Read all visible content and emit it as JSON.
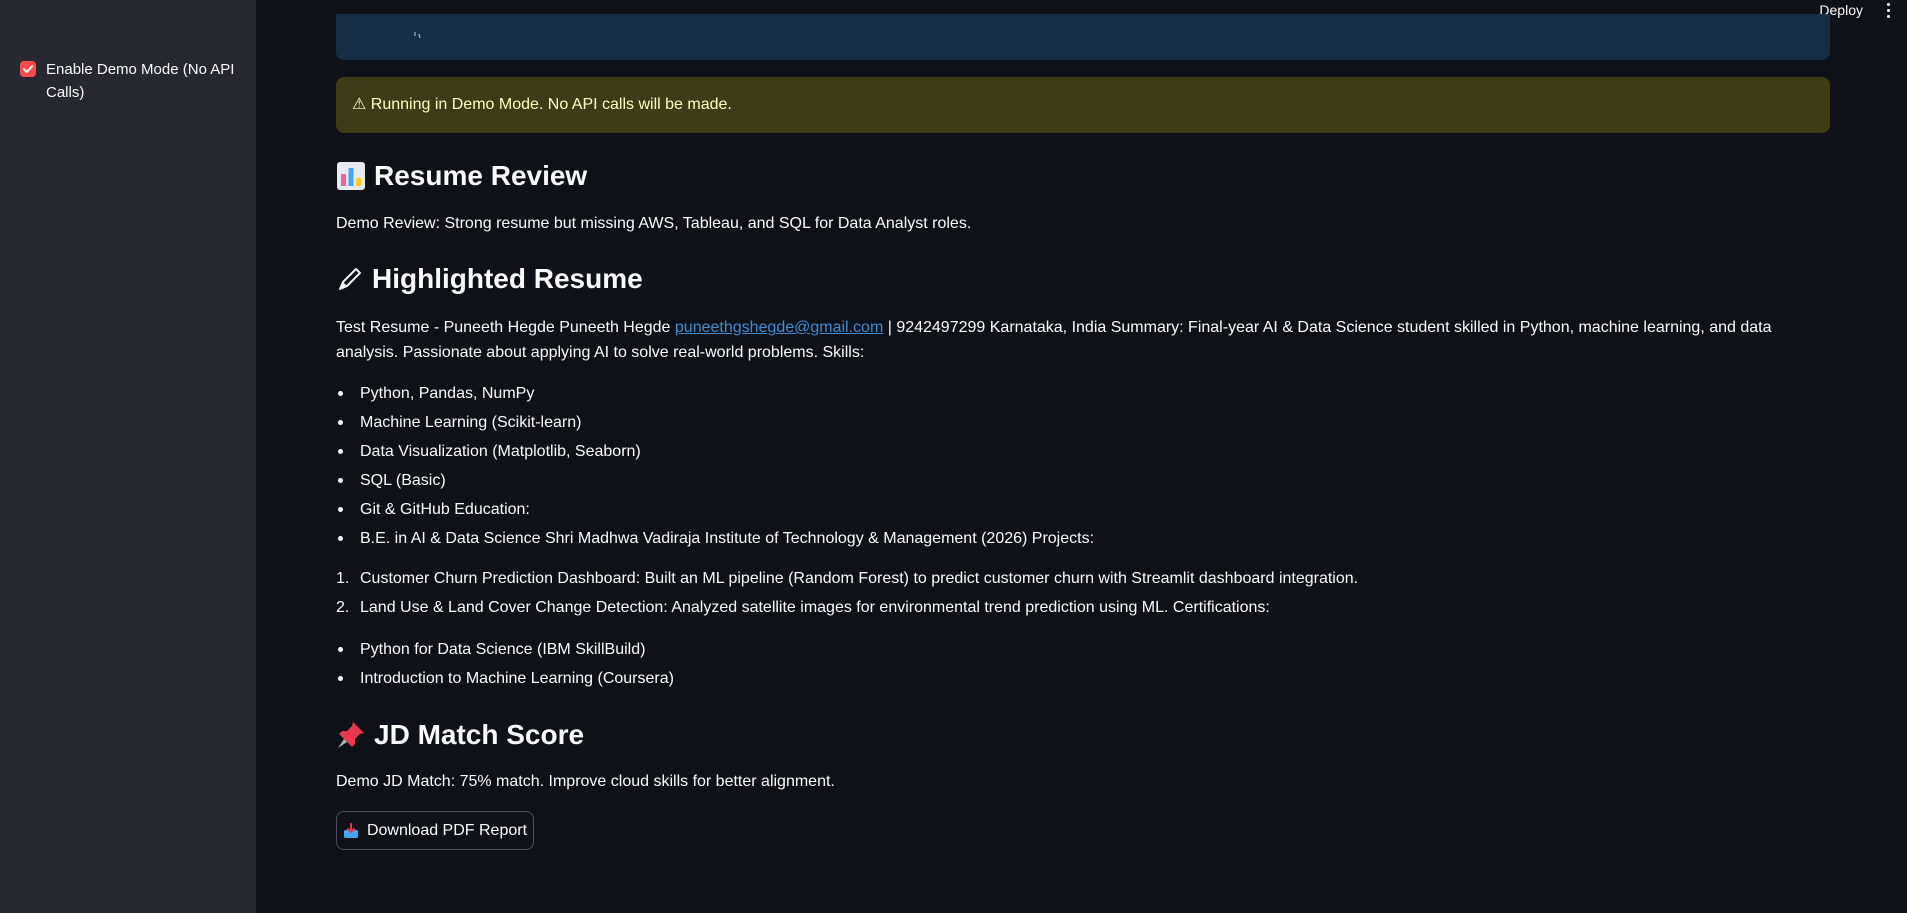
{
  "sidebar": {
    "demo_checkbox": {
      "label": "Enable Demo Mode (No API Calls)",
      "checked": true
    }
  },
  "header": {
    "deploy_label": "Deploy"
  },
  "main": {
    "warning": "⚠ Running in Demo Mode. No API calls will be made.",
    "resume_review": {
      "title": "Resume Review",
      "text": "Demo Review: Strong resume but missing AWS, Tableau, and SQL for Data Analyst roles."
    },
    "highlighted_resume": {
      "title": "Highlighted Resume",
      "intro_before_email": "Test Resume - Puneeth Hegde Puneeth Hegde ",
      "email": "puneethgshegde@gmail.com",
      "intro_after_email": " | 9242497299 Karnataka, India Summary: Final-year AI & Data Science student skilled in Python, machine learning, and data analysis. Passionate about applying AI to solve real-world problems. Skills:",
      "skills": [
        "Python, Pandas, NumPy",
        "Machine Learning (Scikit-learn)",
        "Data Visualization (Matplotlib, Seaborn)",
        "SQL (Basic)",
        "Git & GitHub Education:",
        "B.E. in AI & Data Science Shri Madhwa Vadiraja Institute of Technology & Management (2026) Projects:"
      ],
      "projects": [
        "Customer Churn Prediction Dashboard: Built an ML pipeline (Random Forest) to predict customer churn with Streamlit dashboard integration.",
        "Land Use & Land Cover Change Detection: Analyzed satellite images for environmental trend prediction using ML. Certifications:"
      ],
      "certifications": [
        "Python for Data Science (IBM SkillBuild)",
        "Introduction to Machine Learning (Coursera)"
      ]
    },
    "jd_match": {
      "title": "JD Match Score",
      "text": "Demo JD Match: 75% match. Improve cloud skills for better alignment."
    },
    "download_label": "Download PDF Report"
  },
  "icons": {
    "resume_review": "bar-chart-icon",
    "highlighted_resume": "pen-icon",
    "jd_match": "pushpin-icon",
    "download": "inbox-tray-icon",
    "checkbox": "check-icon"
  },
  "colors": {
    "accent": "#ff4b4b",
    "link": "#3b8ed8",
    "warning_bg": "#3e3b16",
    "warning_text": "#ffffc2",
    "info_bg": "#172d43"
  }
}
